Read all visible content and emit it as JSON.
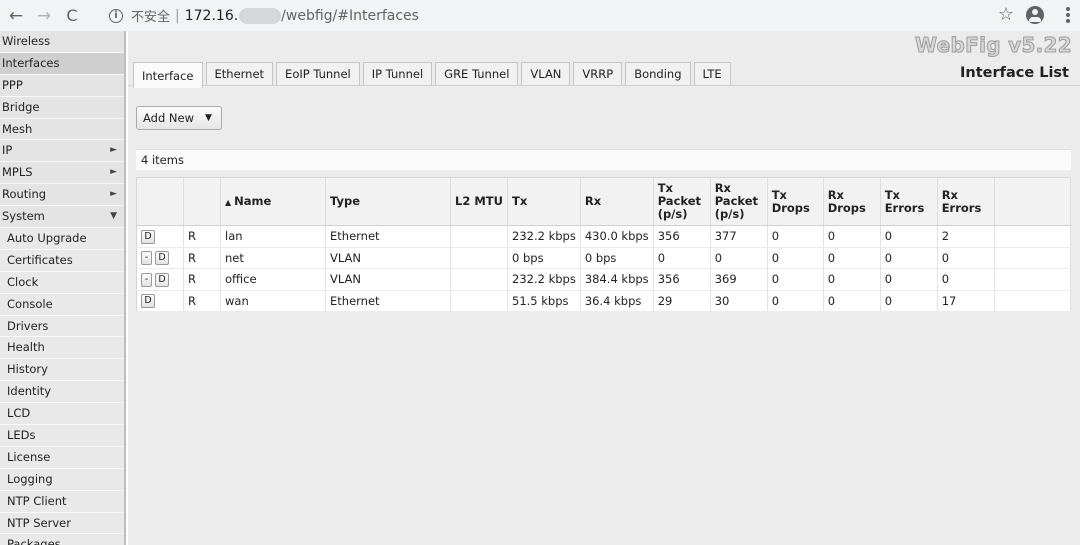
{
  "browser": {
    "security_label": "不安全",
    "separator": "|",
    "url_host": "172.16.",
    "url_path": "/webfig/#Interfaces",
    "back_glyph": "←",
    "forward_glyph": "→",
    "reload_glyph": "C",
    "info_glyph": "i",
    "star_glyph": "☆"
  },
  "sidebar": {
    "arrow_right": "►",
    "arrow_down": "▼",
    "items": [
      {
        "label": "Wireless"
      },
      {
        "label": "Interfaces"
      },
      {
        "label": "PPP"
      },
      {
        "label": "Bridge"
      },
      {
        "label": "Mesh"
      },
      {
        "label": "IP"
      },
      {
        "label": "MPLS"
      },
      {
        "label": "Routing"
      },
      {
        "label": "System"
      },
      {
        "label": "Auto Upgrade"
      },
      {
        "label": "Certificates"
      },
      {
        "label": "Clock"
      },
      {
        "label": "Console"
      },
      {
        "label": "Drivers"
      },
      {
        "label": "Health"
      },
      {
        "label": "History"
      },
      {
        "label": "Identity"
      },
      {
        "label": "LCD"
      },
      {
        "label": "LEDs"
      },
      {
        "label": "License"
      },
      {
        "label": "Logging"
      },
      {
        "label": "NTP Client"
      },
      {
        "label": "NTP Server"
      },
      {
        "label": "Packages"
      }
    ]
  },
  "header": {
    "brand": "WebFig v5.22",
    "page_title": "Interface List"
  },
  "tabs": [
    "Interface",
    "Ethernet",
    "EoIP Tunnel",
    "IP Tunnel",
    "GRE Tunnel",
    "VLAN",
    "VRRP",
    "Bonding",
    "LTE"
  ],
  "toolbar": {
    "add_new_label": "Add New",
    "add_new_caret": "▼"
  },
  "list": {
    "count_label": "4 items",
    "sort_arrow": "▲",
    "columns": {
      "name": "Name",
      "type": "Type",
      "l2mtu": "L2 MTU",
      "tx": "Tx",
      "rx": "Rx",
      "tx_packet_1": "Tx",
      "tx_packet_2": "Packet",
      "tx_packet_3": "(p/s)",
      "rx_packet_1": "Rx",
      "rx_packet_2": "Packet",
      "rx_packet_3": "(p/s)",
      "tx_drops_1": "Tx",
      "tx_drops_2": "Drops",
      "rx_drops_1": "Rx",
      "rx_drops_2": "Drops",
      "tx_errors_1": "Tx",
      "tx_errors_2": "Errors",
      "rx_errors_1": "Rx",
      "rx_errors_2": "Errors"
    },
    "button_minus": "-",
    "button_d": "D",
    "rows": [
      {
        "flag": "R",
        "name": "lan",
        "type": "Ethernet",
        "l2mtu": "",
        "tx": "232.2 kbps",
        "rx": "430.0 kbps",
        "tx_pps": "356",
        "rx_pps": "377",
        "tx_drops": "0",
        "rx_drops": "0",
        "tx_errors": "0",
        "rx_errors": "2"
      },
      {
        "flag": "R",
        "name": "net",
        "type": "VLAN",
        "l2mtu": "",
        "tx": "0 bps",
        "rx": "0 bps",
        "tx_pps": "0",
        "rx_pps": "0",
        "tx_drops": "0",
        "rx_drops": "0",
        "tx_errors": "0",
        "rx_errors": "0"
      },
      {
        "flag": "R",
        "name": "office",
        "type": "VLAN",
        "l2mtu": "",
        "tx": "232.2 kbps",
        "rx": "384.4 kbps",
        "tx_pps": "356",
        "rx_pps": "369",
        "tx_drops": "0",
        "rx_drops": "0",
        "tx_errors": "0",
        "rx_errors": "0"
      },
      {
        "flag": "R",
        "name": "wan",
        "type": "Ethernet",
        "l2mtu": "",
        "tx": "51.5 kbps",
        "rx": "36.4 kbps",
        "tx_pps": "29",
        "rx_pps": "30",
        "tx_drops": "0",
        "rx_drops": "0",
        "tx_errors": "0",
        "rx_errors": "17"
      }
    ]
  }
}
